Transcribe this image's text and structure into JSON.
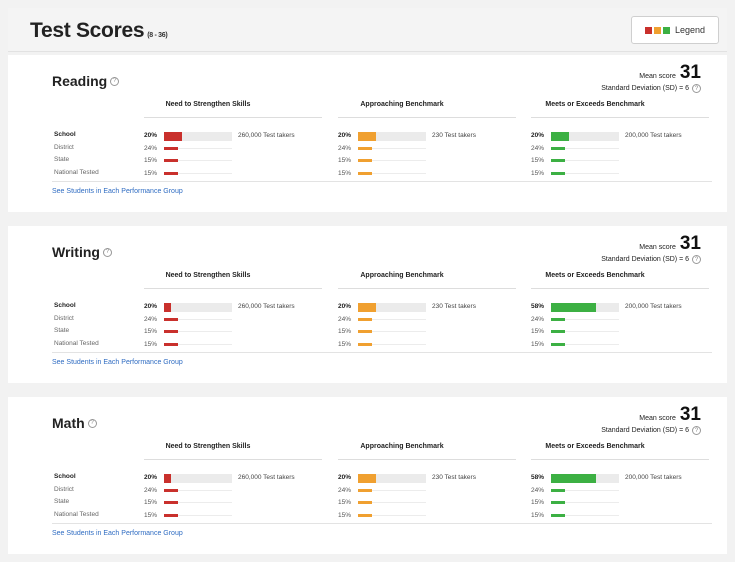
{
  "header": {
    "title": "Test Scores",
    "range": "(8 - 36)",
    "legend_label": "Legend"
  },
  "colors": {
    "need": "#c9302c",
    "approaching": "#f0a030",
    "meets": "#3cb043",
    "link": "#2f6cc2"
  },
  "columns": [
    "Need to Strengthen Skills",
    "Approaching Benchmark",
    "Meets or Exceeds Benchmark"
  ],
  "row_labels": [
    "School",
    "District",
    "State",
    "National Tested"
  ],
  "mean_label": "Mean score",
  "sd_label": "Standard Deviation (SD) = 6",
  "info_glyph": "?",
  "link_text": "See Students in Each Performance Group",
  "sections": [
    {
      "title": "Reading",
      "mean": "31",
      "cells": [
        {
          "school": "20%",
          "school_fill": 0.26,
          "takers": "260,000 Test takers",
          "district": "24%",
          "state": "15%",
          "national": "15%"
        },
        {
          "school": "20%",
          "school_fill": 0.26,
          "takers": "230 Test takers",
          "district": "24%",
          "state": "15%",
          "national": "15%"
        },
        {
          "school": "20%",
          "school_fill": 0.26,
          "takers": "200,000 Test takers",
          "district": "24%",
          "state": "15%",
          "national": "15%"
        }
      ]
    },
    {
      "title": "Writing",
      "mean": "31",
      "cells": [
        {
          "school": "20%",
          "school_fill": 0.1,
          "takers": "260,000 Test takers",
          "district": "24%",
          "state": "15%",
          "national": "15%"
        },
        {
          "school": "20%",
          "school_fill": 0.26,
          "takers": "230 Test takers",
          "district": "24%",
          "state": "15%",
          "national": "15%"
        },
        {
          "school": "58%",
          "school_fill": 0.66,
          "takers": "200,000 Test takers",
          "district": "24%",
          "state": "15%",
          "national": "15%"
        }
      ]
    },
    {
      "title": "Math",
      "mean": "31",
      "cells": [
        {
          "school": "20%",
          "school_fill": 0.1,
          "takers": "260,000 Test takers",
          "district": "24%",
          "state": "15%",
          "national": "15%"
        },
        {
          "school": "20%",
          "school_fill": 0.26,
          "takers": "230 Test takers",
          "district": "24%",
          "state": "15%",
          "national": "15%"
        },
        {
          "school": "58%",
          "school_fill": 0.66,
          "takers": "200,000 Test takers",
          "district": "24%",
          "state": "15%",
          "national": "15%"
        }
      ]
    }
  ]
}
